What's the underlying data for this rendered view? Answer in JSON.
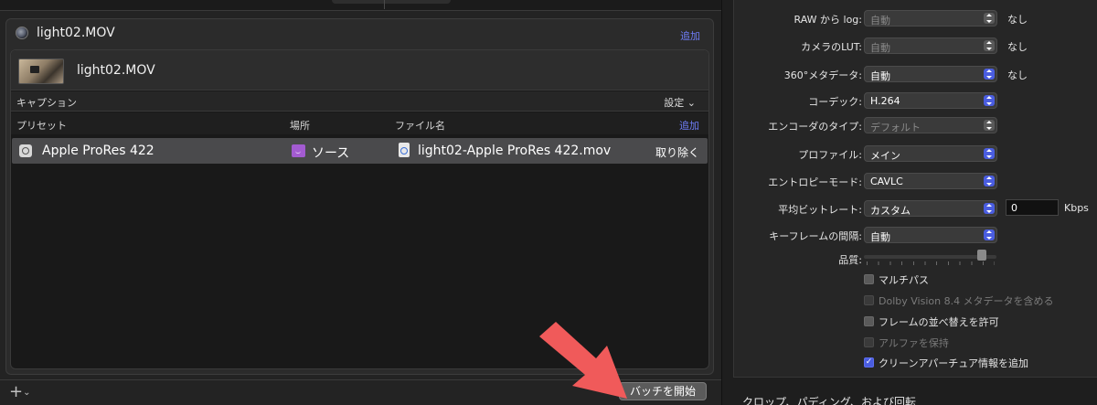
{
  "job": {
    "title": "light02.MOV",
    "add_label": "追加",
    "source_name": "light02.MOV",
    "caption_label": "キャプション",
    "settings_label": "設定 ⌄",
    "columns": {
      "preset": "プリセット",
      "location": "場所",
      "filename": "ファイル名",
      "add": "追加"
    },
    "output": {
      "preset": "Apple ProRes 422",
      "location": "ソース",
      "filename": "light02-Apple ProRes 422.mov",
      "remove": "取り除く"
    }
  },
  "footer": {
    "add_menu": "+",
    "start_batch": "バッチを開始"
  },
  "settings": {
    "raw_to_log": {
      "label": "RAW から log:",
      "value": "自動",
      "side": "なし"
    },
    "camera_lut": {
      "label": "カメラのLUT:",
      "value": "自動",
      "side": "なし"
    },
    "metadata360": {
      "label": "360°メタデータ:",
      "value": "自動",
      "side": "なし"
    },
    "codec": {
      "label": "コーデック:",
      "value": "H.264"
    },
    "encoder_type": {
      "label": "エンコーダのタイプ:",
      "value": "デフォルト"
    },
    "profile": {
      "label": "プロファイル:",
      "value": "メイン"
    },
    "entropy_mode": {
      "label": "エントロピーモード:",
      "value": "CAVLC"
    },
    "avg_bitrate": {
      "label": "平均ビットレート:",
      "value": "カスタム",
      "number": "0",
      "unit": "Kbps"
    },
    "keyframe_interval": {
      "label": "キーフレームの間隔:",
      "value": "自動"
    },
    "quality": {
      "label": "品質:",
      "level": 0.92
    },
    "checkboxes": [
      {
        "label": "マルチパス",
        "checked": false,
        "enabled": true
      },
      {
        "label": "Dolby Vision 8.4 メタデータを含める",
        "checked": false,
        "enabled": false
      },
      {
        "label": "フレームの並べ替えを許可",
        "checked": false,
        "enabled": true
      },
      {
        "label": "アルファを保持",
        "checked": false,
        "enabled": false
      },
      {
        "label": "クリーンアパーチュア情報を追加",
        "checked": true,
        "enabled": true
      }
    ],
    "crop_heading": "クロップ、パディング、および回転"
  },
  "colors": {
    "accent": "#4a5de0",
    "link": "#6e7cf5",
    "arrow": "#f05a5a"
  }
}
